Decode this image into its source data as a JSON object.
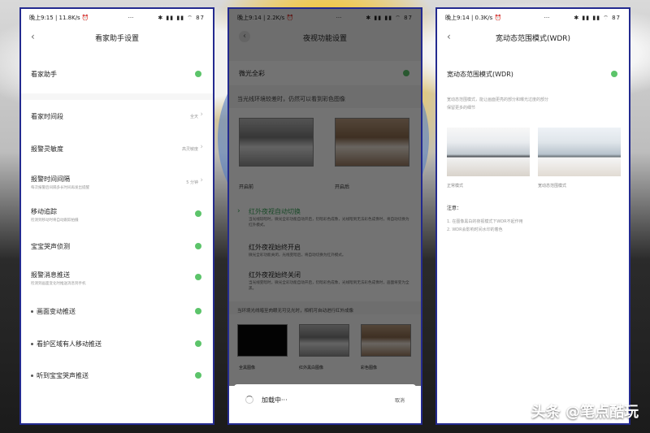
{
  "watermark": "头条 @笔点酷玩",
  "phone1": {
    "status": {
      "time": "晚上9:15 | 11.8K/s ⏰",
      "dots": "···",
      "icons": "✱ ▮▮ ▮▮ ⌔ 87"
    },
    "title": "看家助手设置",
    "items": [
      {
        "label": "看家助手",
        "toggle": true
      },
      {
        "label": "看家时间段",
        "value": "全天"
      },
      {
        "label": "报警灵敏度",
        "value": "高灵敏度"
      },
      {
        "label": "报警时间间隔",
        "sub": "每次报警后间隔多长时间再发出提醒",
        "value": "5 分钟"
      },
      {
        "label": "移动追踪",
        "sub": "检测到移动时将自动跟踪拍摄",
        "toggle": true
      },
      {
        "label": "宝宝哭声侦测",
        "toggle": true
      },
      {
        "label": "报警消息推送",
        "sub": "检测到画面变化时推送消息到手机",
        "toggle": true
      },
      {
        "label": "画面变动推送",
        "toggle": true
      },
      {
        "label": "看护区域有人移动推送",
        "toggle": true
      },
      {
        "label": "听到宝宝哭声推送",
        "toggle": true
      }
    ]
  },
  "phone2": {
    "status": {
      "time": "晚上9:14 | 2.2K/s ⏰",
      "dots": "···",
      "icons": "✱ ▮▮ ▮▮ ⌔ 87"
    },
    "title": "夜视功能设置",
    "toggle_label": "微光全彩",
    "hint": "当光线环境较差时，仍然可以看到彩色图像",
    "before_label": "开启前",
    "after_label": "开启后",
    "options": [
      {
        "title": "红外夜视自动切换",
        "desc": "当光线较暗时，微光全彩功能自动开启，仍暗彩色成像，光线暗到无法彩色成像时，将自动切换为红外模式。",
        "active": true
      },
      {
        "title": "红外夜视始终开启",
        "desc": "微光全彩功能关闭，光线变暗后，将自动切换为红外模式。"
      },
      {
        "title": "红外夜视始终关闭",
        "desc": "当光线变暗时，微光全彩功能自动开启，仍暗彩色成像，光线暗到无法彩色成像时，画面将变为全黑。"
      }
    ],
    "note": "当环境光线暗至肉眼无可见光时，相机可自动进行红外成像",
    "thumbs": [
      "全黑图像",
      "红外黑白图像",
      "彩色图像"
    ],
    "loading_text": "加载中···",
    "cancel": "取消"
  },
  "phone3": {
    "status": {
      "time": "晚上9:14 | 0.3K/s ⏰",
      "dots": "···",
      "icons": "✱ ▮▮ ▮▮ ⌔ 87"
    },
    "title": "宽动态范围模式(WDR)",
    "toggle_label": "宽动态范围模式(WDR)",
    "desc_line1": "宽动态范围模式，能让画面更亮的部分和曝光过度的部分",
    "desc_line2": "保留更多的细节",
    "normal_label": "正常模式",
    "wdr_label": "宽动态范围模式",
    "note_title": "注意：",
    "notes": [
      "1. 在图像黑白的夜视模式下WDR不起作用",
      "2. WDR会影响时间水印的着色"
    ]
  }
}
